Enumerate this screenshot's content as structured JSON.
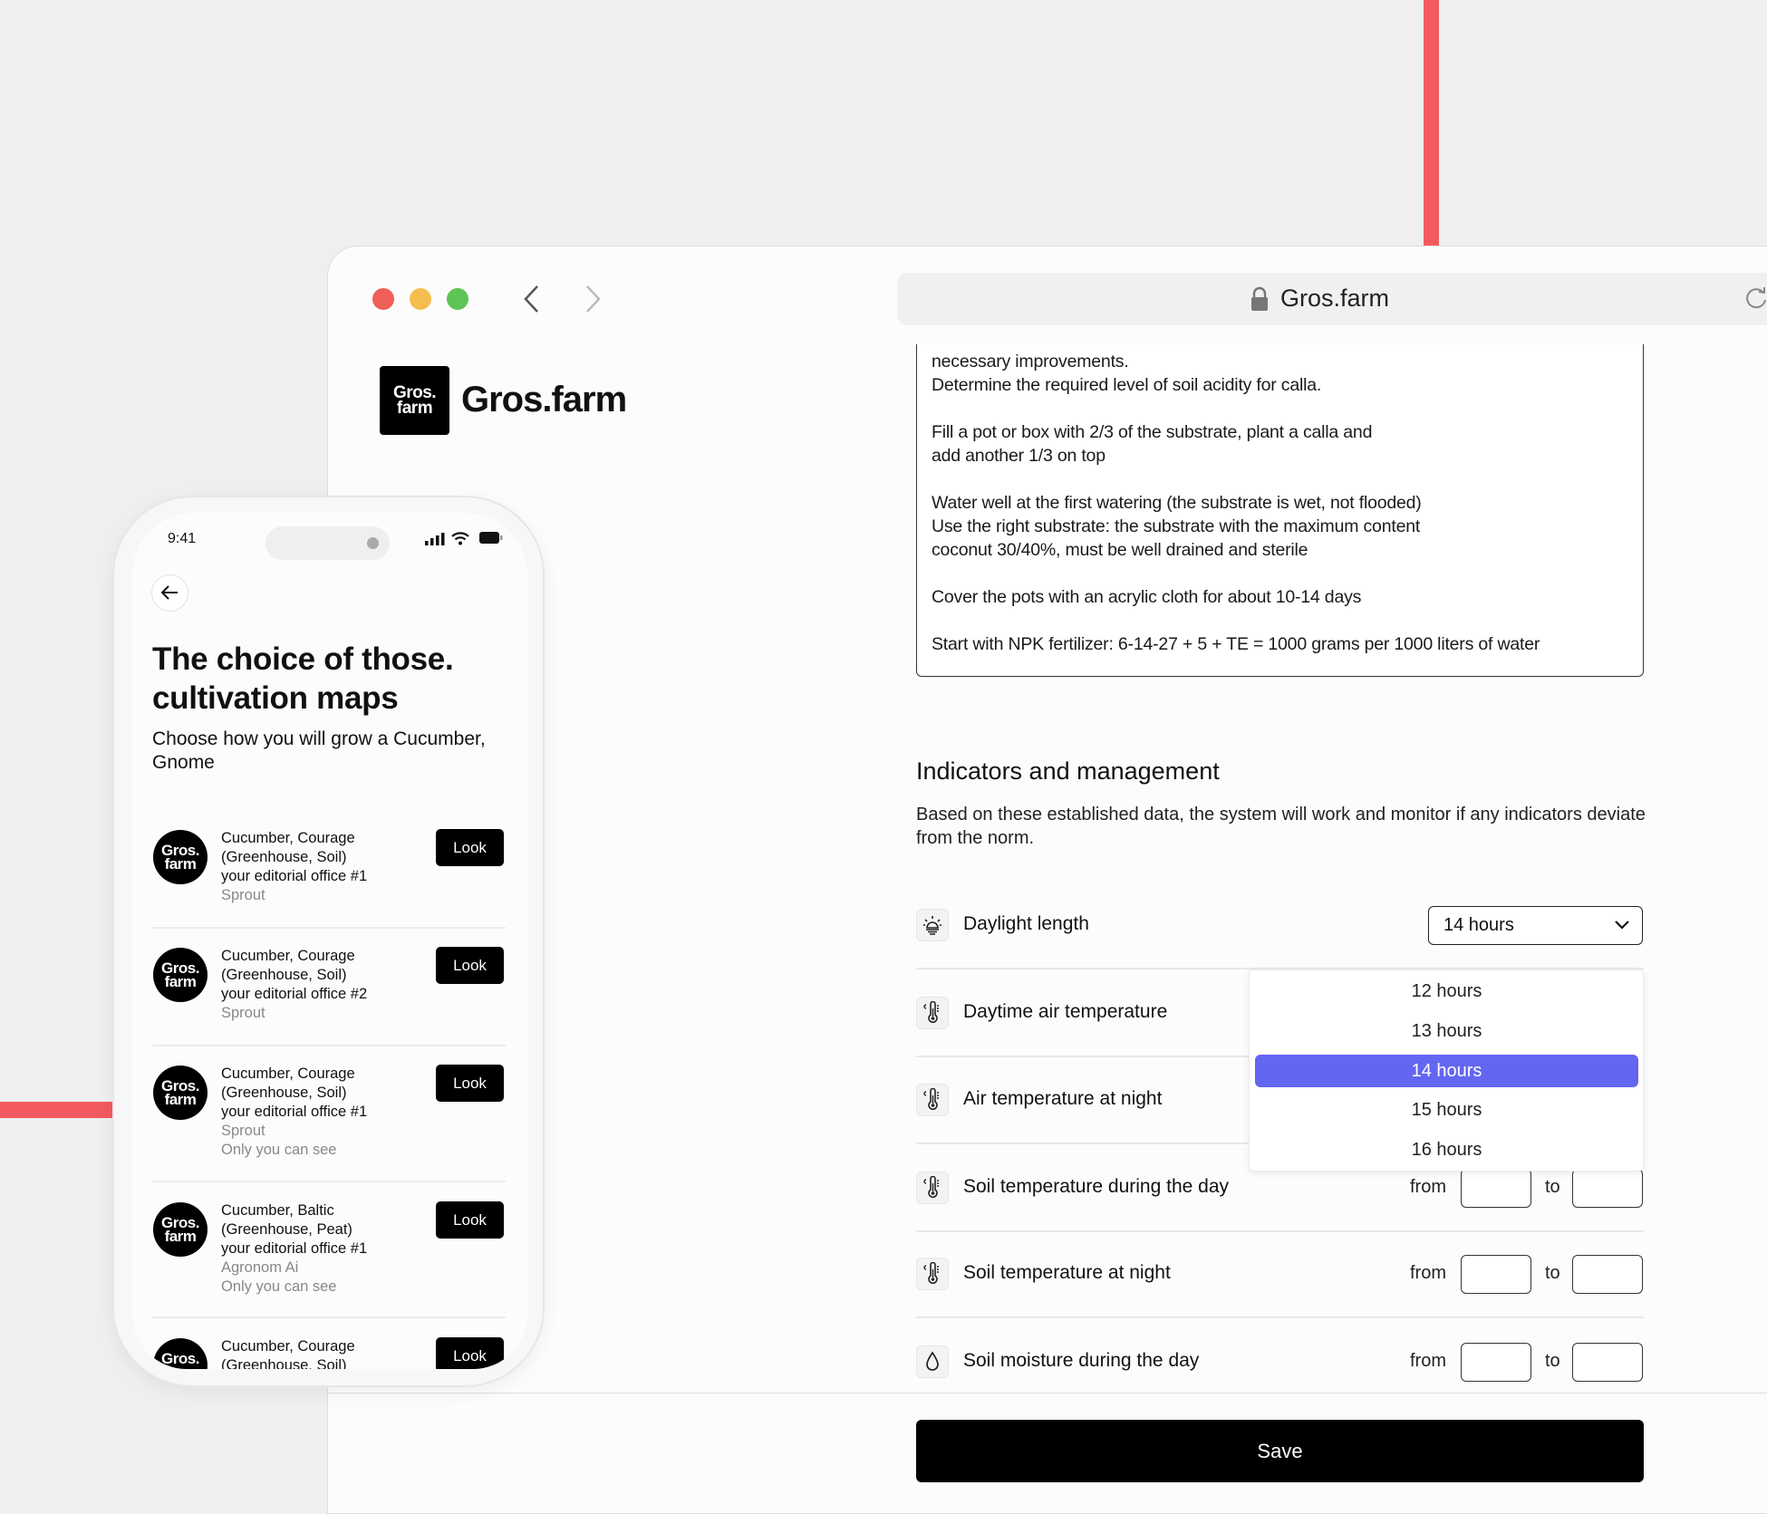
{
  "browser": {
    "url": "Gros.farm",
    "icons": [
      "lock-icon",
      "reload-icon",
      "chevron-left-icon",
      "chevron-right-icon"
    ],
    "traffic_lights": {
      "close": "#ee5f57",
      "minimize": "#f5bd4f",
      "maximize": "#5ec454"
    }
  },
  "brand": {
    "logo_text": "Gros. farm",
    "name": "Gros.farm"
  },
  "instructions": [
    [
      "necessary improvements.",
      "Determine the required level of soil acidity for calla."
    ],
    [
      "Fill a pot or box with 2/3 of the substrate, plant a calla and",
      "add another 1/3 on top"
    ],
    [
      "Water well at the first watering (the substrate is wet, not flooded)",
      "Use the right substrate: the substrate with the maximum content",
      "coconut 30/40%, must be well drained and sterile"
    ],
    [
      "Cover the pots with an acrylic cloth for about 10-14 days"
    ],
    [
      "Start with NPK fertilizer: 6-14-27 + 5 + TE = 1000 grams per 1000 liters of water"
    ]
  ],
  "indicators": {
    "title": "Indicators and management",
    "description": "Based on these established data, the system will work and monitor if any indicators deviate from the norm.",
    "rows": [
      {
        "label": "Daylight length",
        "icon": "daylight-icon"
      },
      {
        "label": "Daytime air temperature",
        "icon": "thermometer-icon"
      },
      {
        "label": "Air temperature at night",
        "icon": "thermometer-icon"
      },
      {
        "label": "Soil temperature during the day",
        "icon": "thermometer-icon"
      },
      {
        "label": "Soil temperature at night",
        "icon": "thermometer-icon"
      },
      {
        "label": "Soil moisture during the day",
        "icon": "drop-icon"
      }
    ],
    "daylight_select": {
      "value": "14 hours",
      "options": [
        "12 hours",
        "13 hours",
        "14 hours",
        "15 hours",
        "16 hours"
      ],
      "selected_index": 2,
      "highlight_color": "#6366f1"
    },
    "from_label": "from",
    "to_label": "to",
    "save_label": "Save"
  },
  "phone": {
    "time": "9:41",
    "title_lines": [
      "The choice of those.",
      "cultivation maps"
    ],
    "subtitle_lines": [
      "Choose how you will grow a Cucumber,",
      "Gnome"
    ],
    "avatar_text": [
      "Gros.",
      "farm"
    ],
    "look_label": "Look",
    "items": [
      {
        "lines": [
          "Cucumber, Courage",
          "(Greenhouse, Soil)",
          "your editorial office #1"
        ],
        "sub": [
          "Sprout"
        ]
      },
      {
        "lines": [
          "Cucumber, Courage",
          "(Greenhouse, Soil)",
          "your editorial office #2"
        ],
        "sub": [
          "Sprout"
        ]
      },
      {
        "lines": [
          "Cucumber, Courage",
          "(Greenhouse, Soil)",
          "your editorial office #1"
        ],
        "sub": [
          "Sprout",
          "Only you can see"
        ]
      },
      {
        "lines": [
          "Cucumber, Baltic",
          "(Greenhouse, Peat)",
          "your editorial office #1"
        ],
        "sub": [
          "Agronom Ai",
          "Only you can see"
        ]
      },
      {
        "lines": [
          "Cucumber, Courage",
          "(Greenhouse, Soil)"
        ],
        "sub": []
      }
    ]
  }
}
